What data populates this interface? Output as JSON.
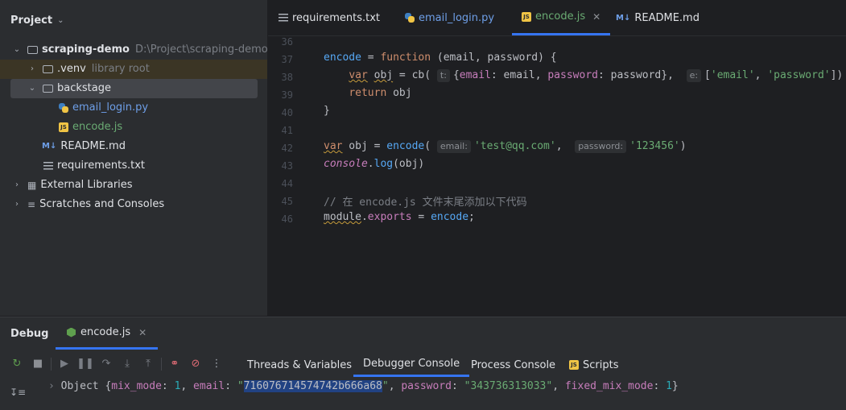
{
  "project": {
    "title": "Project",
    "tree": [
      {
        "label": "scraping-demo",
        "hint": "D:\\Project\\scraping-demo"
      },
      {
        "label": ".venv",
        "hint": "library root"
      },
      {
        "label": "backstage"
      },
      {
        "label": "email_login.py"
      },
      {
        "label": "encode.js"
      },
      {
        "label": "README.md"
      },
      {
        "label": "requirements.txt"
      },
      {
        "label": "External Libraries"
      },
      {
        "label": "Scratches and Consoles"
      }
    ]
  },
  "tabs": [
    {
      "label": "requirements.txt"
    },
    {
      "label": "email_login.py"
    },
    {
      "label": "encode.js",
      "active": true
    },
    {
      "label": "README.md"
    }
  ],
  "editor": {
    "line_numbers": [
      "36",
      "37",
      "38",
      "39",
      "40",
      "41",
      "42",
      "43",
      "44",
      "45",
      "46"
    ],
    "hints": {
      "t": "t:",
      "e": "e:",
      "email": "email:",
      "password": "password:"
    },
    "comment": "// 在 encode.js 文件末尾添加以下代码"
  },
  "debug": {
    "title": "Debug",
    "session_tab": "encode.js",
    "subtabs": [
      "Threads & Variables",
      "Debugger Console",
      "Process Console",
      "Scripts"
    ],
    "console": {
      "prefix": "Object {",
      "mix_mode_key": "mix_mode",
      "mix_mode_val": "1",
      "email_key": "email",
      "email_val": "716076714574742b666a68",
      "password_key": "password",
      "password_val": "\"343736313033\"",
      "fixed_key": "fixed_mix_mode",
      "fixed_val": "1"
    }
  },
  "colors": {
    "accent": "#3574f0",
    "keyword": "#cf8e6d",
    "function": "#56a8f5",
    "string": "#6aab73",
    "selection": "#214283"
  }
}
